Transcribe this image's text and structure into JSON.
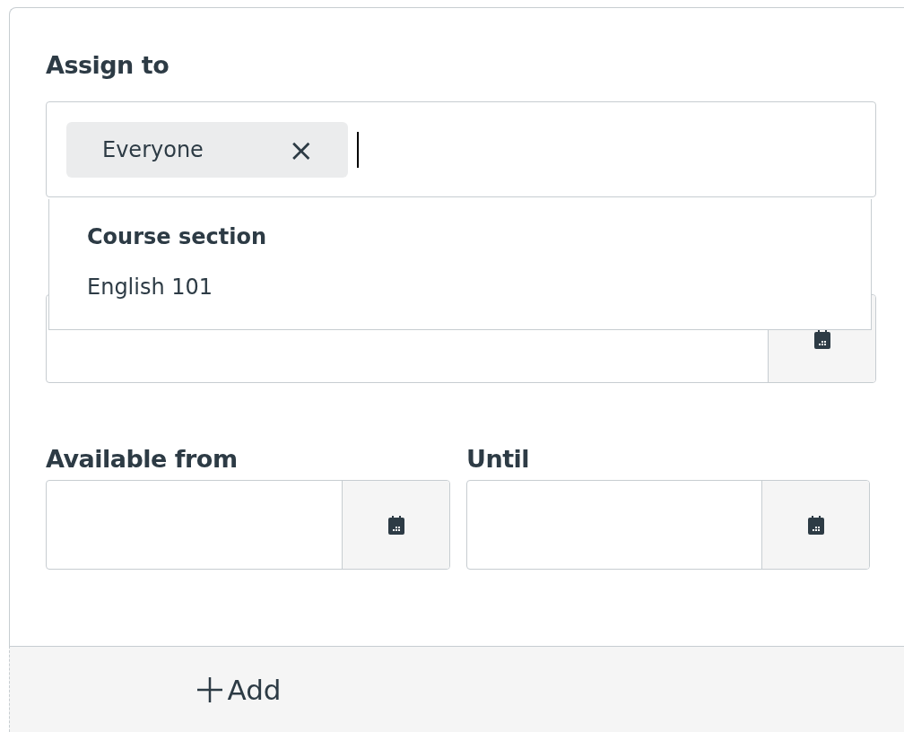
{
  "assign_to": {
    "label": "Assign to",
    "tokens": [
      {
        "label": "Everyone",
        "remove_icon": "×"
      }
    ],
    "dropdown": {
      "group_label": "Course section",
      "options": [
        {
          "label": "English 101",
          "selected": false
        }
      ]
    }
  },
  "date_fields": [
    {
      "label": "Available from"
    },
    {
      "label": "Until"
    }
  ],
  "add_button": {
    "label": "Add"
  }
}
